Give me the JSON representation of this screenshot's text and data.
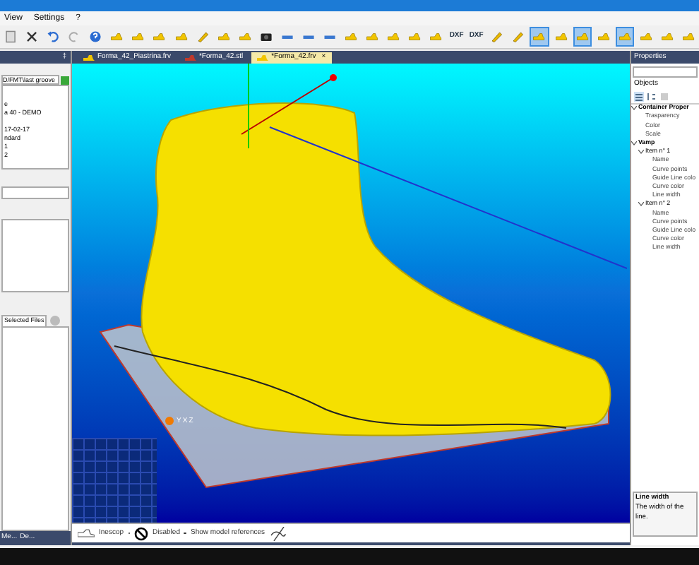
{
  "menu": [
    "View",
    "Settings",
    "?"
  ],
  "toolbar": [
    {
      "kind": "doc",
      "selected": false
    },
    {
      "kind": "cut",
      "selected": false
    },
    {
      "kind": "undo",
      "selected": false
    },
    {
      "kind": "redo",
      "selected": false
    },
    {
      "kind": "help",
      "selected": false
    },
    {
      "kind": "shoe",
      "selected": false
    },
    {
      "kind": "shoe",
      "selected": false
    },
    {
      "kind": "shoe",
      "selected": false
    },
    {
      "kind": "shoe",
      "selected": false
    },
    {
      "kind": "pencil",
      "selected": false
    },
    {
      "kind": "shoe",
      "selected": false
    },
    {
      "kind": "shoe",
      "selected": false
    },
    {
      "kind": "camera",
      "selected": false
    },
    {
      "kind": "bar",
      "selected": false
    },
    {
      "kind": "bar",
      "selected": false
    },
    {
      "kind": "bar",
      "selected": false
    },
    {
      "kind": "shoe",
      "selected": false
    },
    {
      "kind": "shoe",
      "selected": false
    },
    {
      "kind": "shoe",
      "selected": false
    },
    {
      "kind": "shoe",
      "selected": false
    },
    {
      "kind": "shoe",
      "selected": false
    },
    {
      "kind": "dxf",
      "label": "DXF",
      "selected": false
    },
    {
      "kind": "dxf",
      "label": "DXF",
      "selected": false
    },
    {
      "kind": "pencil",
      "selected": false
    },
    {
      "kind": "pencil",
      "selected": false
    },
    {
      "kind": "shoe",
      "selected": true
    },
    {
      "kind": "shoe",
      "selected": false
    },
    {
      "kind": "shoe",
      "selected": true
    },
    {
      "kind": "shoe",
      "selected": false
    },
    {
      "kind": "shoe",
      "selected": true
    },
    {
      "kind": "shoe",
      "selected": false
    },
    {
      "kind": "shoe",
      "selected": false
    },
    {
      "kind": "shoe",
      "selected": false
    }
  ],
  "tabs": [
    {
      "label": "Forma_42_Piastrina.frv",
      "selected": false
    },
    {
      "label": "*Forma_42.stl",
      "selected": false
    },
    {
      "label": "*Forma_42.frv",
      "selected": true,
      "close": "×"
    }
  ],
  "left_panel": {
    "pin": "‡",
    "path": "D/FMT\\last groove",
    "info": [
      "e",
      "a 40 - DEMO",
      "17-02-17",
      "ndard",
      "1",
      "2"
    ],
    "files_tab": "Selected Files",
    "bottom_tabs": [
      "Me...",
      "De..."
    ]
  },
  "viewport": {
    "axes": [
      "Y",
      "X",
      "Z"
    ]
  },
  "status": {
    "items": [
      "Inescop",
      "Disabled",
      "Show model references"
    ]
  },
  "properties": {
    "title": "Properties",
    "objects_label": "Objects",
    "tree": [
      {
        "label": "Container Proper",
        "expanded": true,
        "children": [
          {
            "label": "Trasparency"
          },
          {
            "label": "Color"
          },
          {
            "label": "Scale"
          }
        ]
      },
      {
        "label": "Vamp",
        "expanded": true,
        "children": [
          {
            "label": "Item n° 1",
            "expanded": true,
            "children": [
              {
                "label": "Name"
              },
              {
                "label": "Curve points"
              },
              {
                "label": "Guide Line colo"
              },
              {
                "label": "Curve color"
              },
              {
                "label": "Line width"
              }
            ]
          },
          {
            "label": "Item n° 2",
            "expanded": true,
            "children": [
              {
                "label": "Name"
              },
              {
                "label": "Curve points"
              },
              {
                "label": "Guide Line colo"
              },
              {
                "label": "Curve color"
              },
              {
                "label": "Line width"
              }
            ]
          }
        ]
      }
    ],
    "help_title": "Line width",
    "help_text": "The width of the line."
  }
}
